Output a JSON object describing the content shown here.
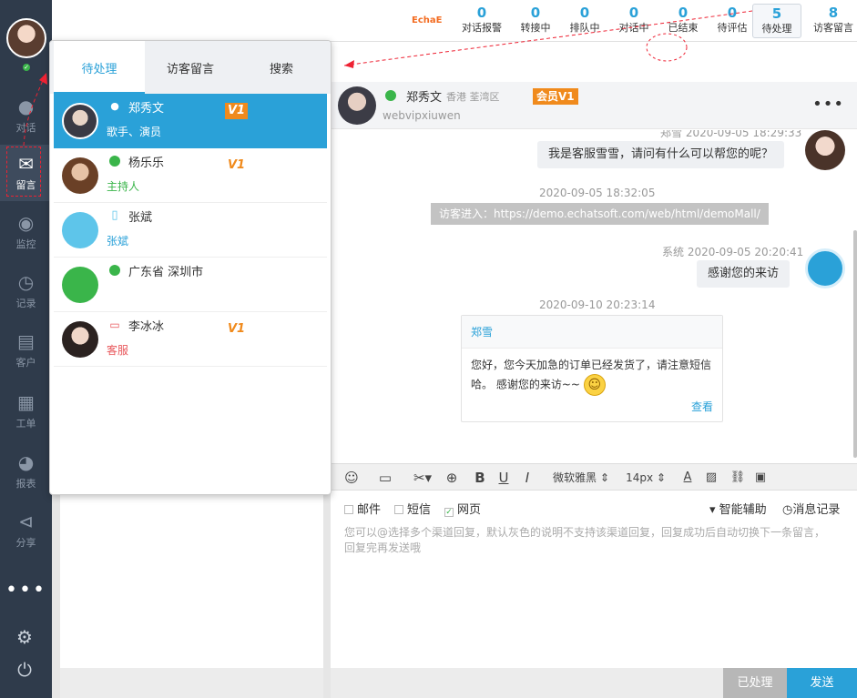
{
  "nav": {
    "items": [
      {
        "label": "对话",
        "icon": "chat-bubble-icon"
      },
      {
        "label": "留言",
        "icon": "envelope-icon"
      },
      {
        "label": "监控",
        "icon": "eye-icon"
      },
      {
        "label": "记录",
        "icon": "clock-icon"
      },
      {
        "label": "客户",
        "icon": "contact-card-icon"
      },
      {
        "label": "工单",
        "icon": "clipboard-icon"
      },
      {
        "label": "报表",
        "icon": "pie-chart-icon"
      },
      {
        "label": "分享",
        "icon": "share-icon"
      }
    ],
    "more": "•••"
  },
  "topbar": {
    "logo": "EchaE",
    "stats": [
      {
        "count": "0",
        "label": "对话报警"
      },
      {
        "count": "0",
        "label": "转接中"
      },
      {
        "count": "0",
        "label": "排队中"
      },
      {
        "count": "0",
        "label": "对话中"
      },
      {
        "count": "0",
        "label": "已结束"
      },
      {
        "count": "0",
        "label": "待评估"
      },
      {
        "count": "5",
        "label": "待处理"
      },
      {
        "count": "8",
        "label": "访客留言"
      }
    ]
  },
  "popup": {
    "tabs": [
      "待处理",
      "访客留言",
      "搜索"
    ],
    "rows": [
      {
        "name": "郑秀文",
        "sub": "歌手、演员",
        "vip": "V1",
        "sub_color": "#ffffff"
      },
      {
        "name": "杨乐乐",
        "sub": "主持人",
        "vip": "V1",
        "sub_color": "#3ab54a"
      },
      {
        "name": "张斌",
        "sub": "张斌",
        "vip": "",
        "sub_color": "#2aa1d8"
      },
      {
        "name": "广东省 深圳市",
        "sub": "",
        "vip": "",
        "sub_color": "#333333"
      },
      {
        "name": "李冰冰",
        "sub": "客服",
        "vip": "V1",
        "sub_color": "#e8565a"
      }
    ]
  },
  "chat": {
    "name": "郑秀文",
    "location": "香港 荃湾区",
    "vip": "会员V1",
    "uid": "webvipxiuwen",
    "more": "•••",
    "messages": {
      "m1_meta": "郑雪 2020-09-05 18:29:33",
      "m1_text": "我是客服雪雪，请问有什么可以帮您的呢？",
      "m2_meta": "2020-09-05 18:32:05",
      "m2_text": "访客进入：https://demo.echatsoft.com/web/html/demoMall/",
      "m3_meta": "系统 2020-09-05 20:20:41",
      "m3_text": "感谢您的来访",
      "m4_meta": "2020-09-10 20:23:14",
      "card_title": "郑雪",
      "card_line1": "您好，您今天加急的订单已经发货了，请注意短信",
      "card_line2": "哈。 感谢您的来访~~",
      "card_view": "查看"
    }
  },
  "toolbar": {
    "font": "微软雅黑",
    "size": "14px"
  },
  "channels": {
    "mail": "邮件",
    "sms": "短信",
    "web": "网页",
    "assist": "智能辅助",
    "history": "消息记录"
  },
  "hint_line1": "您可以@选择多个渠道回复，默认灰色的说明不支持该渠道回复，回复成功后自动切换下一条留言，",
  "hint_line2": "回复完再发送哦",
  "buttons": {
    "done": "已处理",
    "send": "发送"
  }
}
